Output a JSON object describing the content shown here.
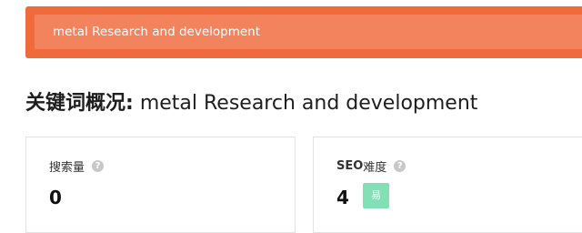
{
  "search": {
    "value": "metal Research and development"
  },
  "overview": {
    "prefix": "关键词概况:",
    "keyword": "metal Research and development"
  },
  "cards": {
    "volume": {
      "label": "搜索量",
      "help_icon": "?",
      "value": "0"
    },
    "seo": {
      "label_strong": "SEO",
      "label_rest": "难度",
      "help_icon": "?",
      "value": "4",
      "badge": "易"
    }
  },
  "colors": {
    "band": "#f06a3c",
    "input": "#f3835d",
    "badge": "#82e0b5"
  },
  "icons": {
    "help": "question-circle-icon"
  }
}
